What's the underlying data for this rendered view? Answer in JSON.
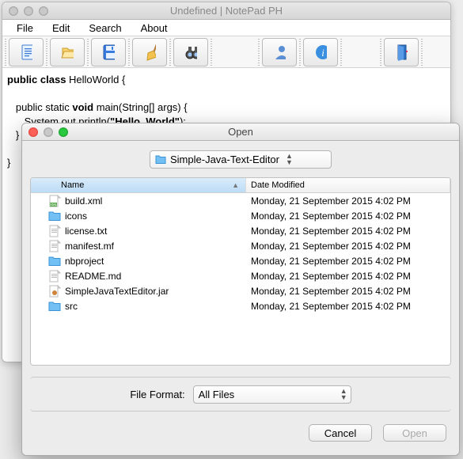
{
  "main": {
    "title": "Undefined | NotePad PH",
    "menu": {
      "file": "File",
      "edit": "Edit",
      "search": "Search",
      "about": "About"
    },
    "editor": {
      "l1a": "public class",
      "l1b": " HelloWorld {",
      "l2a": "   public static ",
      "l2b": "void",
      "l2c": " main(String[] args) {",
      "l3a": "      System.out.println(",
      "l3b": "\"Hello, World\"",
      "l3c": ");",
      "l4": "   }",
      "l5": "}"
    }
  },
  "dialog": {
    "title": "Open",
    "folder": "Simple-Java-Text-Editor",
    "cols": {
      "name": "Name",
      "date": "Date Modified"
    },
    "files": [
      {
        "icon": "xml",
        "name": "build.xml",
        "date": "Monday, 21 September 2015 4:02 PM"
      },
      {
        "icon": "folder",
        "name": "icons",
        "date": "Monday, 21 September 2015 4:02 PM"
      },
      {
        "icon": "txt",
        "name": "license.txt",
        "date": "Monday, 21 September 2015 4:02 PM"
      },
      {
        "icon": "txt",
        "name": "manifest.mf",
        "date": "Monday, 21 September 2015 4:02 PM"
      },
      {
        "icon": "folder",
        "name": "nbproject",
        "date": "Monday, 21 September 2015 4:02 PM"
      },
      {
        "icon": "txt",
        "name": "README.md",
        "date": "Monday, 21 September 2015 4:02 PM"
      },
      {
        "icon": "jar",
        "name": "SimpleJavaTextEditor.jar",
        "date": "Monday, 21 September 2015 4:02 PM"
      },
      {
        "icon": "folder",
        "name": "src",
        "date": "Monday, 21 September 2015 4:02 PM"
      }
    ],
    "format_label": "File Format:",
    "format_value": "All Files",
    "cancel": "Cancel",
    "open": "Open"
  }
}
